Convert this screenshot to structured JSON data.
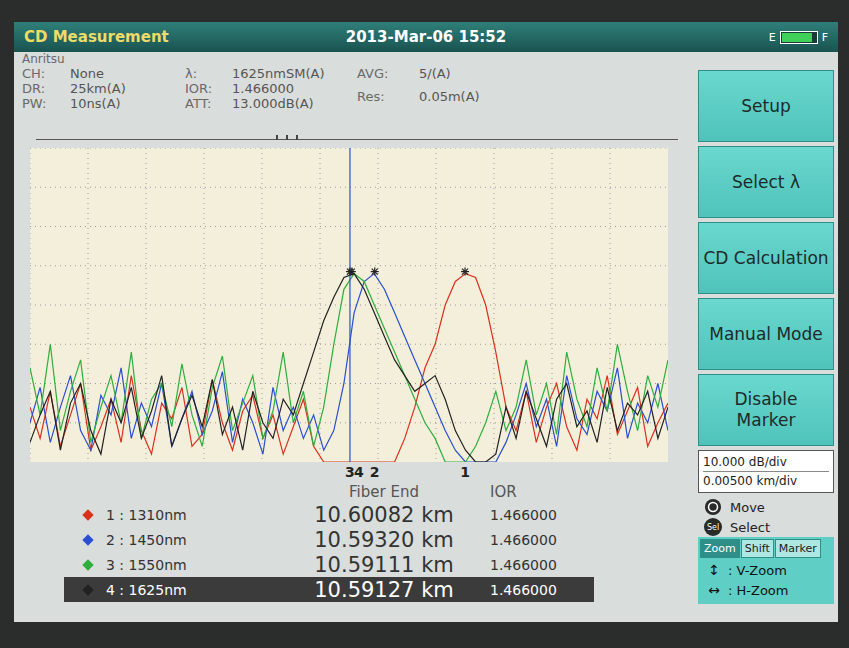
{
  "header": {
    "title": "CD Measurement",
    "datetime": "2013-Mar-06 15:52",
    "battery": {
      "empty_label": "E",
      "full_label": "F",
      "level": 0.9
    }
  },
  "brand": "Anritsu",
  "params": [
    [
      {
        "label": "CH:",
        "value": "None"
      },
      {
        "label": "DR:",
        "value": "25km(A)"
      },
      {
        "label": "PW:",
        "value": "10ns(A)"
      }
    ],
    [
      {
        "label": "λ:",
        "value": "1625nmSM(A)"
      },
      {
        "label": "IOR:",
        "value": "1.466000"
      },
      {
        "label": "ATT:",
        "value": "13.000dB(A)"
      }
    ],
    [
      {
        "label": "AVG:",
        "value": "5/(A)"
      },
      {
        "label": "Res:",
        "value": "0.05m(A)"
      }
    ]
  ],
  "chart": {
    "x_start_km": 10.56411,
    "x_end_km": 10.61795,
    "y_min_db": 0,
    "y_max_db": 80,
    "cursor_km": 10.59111,
    "series": [
      {
        "id": "1",
        "legend": "1 : 1310nm",
        "fiber_end": "10.60082 km",
        "ior": "1.466000",
        "km": 10.60082,
        "color": "#d8321e",
        "selected": false,
        "values": [
          14,
          6,
          18,
          4,
          12,
          20,
          3,
          9,
          16,
          5,
          22,
          8,
          2,
          15,
          11,
          19,
          4,
          7,
          21,
          10,
          3,
          13,
          17,
          6,
          12,
          2,
          9,
          16,
          4,
          0,
          0,
          0,
          0,
          0,
          0,
          0,
          0,
          6,
          14,
          24,
          30,
          40,
          46,
          48,
          47,
          40,
          28,
          14,
          8,
          18,
          5,
          14,
          20,
          9,
          3,
          16,
          11,
          22,
          7,
          13,
          19,
          4,
          10,
          15
        ]
      },
      {
        "id": "2",
        "legend": "2 : 1450nm",
        "fiber_end": "10.59320 km",
        "ior": "1.466000",
        "km": 10.5932,
        "color": "#2a4fd0",
        "selected": false,
        "values": [
          10,
          19,
          5,
          14,
          22,
          8,
          3,
          17,
          12,
          24,
          6,
          15,
          9,
          20,
          4,
          11,
          18,
          7,
          13,
          23,
          5,
          16,
          10,
          2,
          19,
          8,
          14,
          6,
          12,
          3,
          8,
          20,
          38,
          46,
          48,
          44,
          38,
          32,
          26,
          20,
          14,
          8,
          3,
          0,
          0,
          0,
          0,
          5,
          12,
          20,
          9,
          16,
          4,
          22,
          11,
          7,
          18,
          13,
          24,
          6,
          15,
          10,
          20,
          8
        ]
      },
      {
        "id": "3",
        "legend": "3 : 1550nm",
        "fiber_end": "10.59111 km",
        "ior": "1.466000",
        "km": 10.59111,
        "color": "#2fae3e",
        "selected": false,
        "values": [
          24,
          12,
          30,
          8,
          18,
          26,
          5,
          14,
          22,
          10,
          28,
          6,
          16,
          20,
          9,
          25,
          12,
          4,
          19,
          27,
          8,
          15,
          22,
          6,
          13,
          28,
          10,
          18,
          4,
          14,
          30,
          44,
          48,
          46,
          40,
          34,
          28,
          22,
          16,
          10,
          6,
          0,
          0,
          0,
          4,
          10,
          18,
          8,
          14,
          26,
          12,
          20,
          7,
          28,
          16,
          9,
          24,
          13,
          30,
          18,
          8,
          22,
          14,
          26
        ]
      },
      {
        "id": "4",
        "legend": "4 : 1625nm",
        "fiber_end": "10.59127 km",
        "ior": "1.466000",
        "km": 10.59127,
        "color": "#222222",
        "selected": true,
        "values": [
          5,
          12,
          18,
          3,
          15,
          20,
          8,
          2,
          16,
          10,
          19,
          6,
          13,
          22,
          4,
          11,
          17,
          9,
          21,
          7,
          14,
          3,
          18,
          10,
          6,
          16,
          12,
          20,
          28,
          36,
          42,
          47,
          48,
          44,
          38,
          32,
          26,
          22,
          18,
          20,
          22,
          16,
          8,
          3,
          0,
          0,
          2,
          14,
          6,
          18,
          11,
          4,
          16,
          20,
          9,
          13,
          5,
          19,
          8,
          15,
          12,
          18,
          6,
          14
        ]
      }
    ]
  },
  "table": {
    "columns": [
      "Fiber End",
      "IOR"
    ]
  },
  "menu": [
    {
      "label": "Setup"
    },
    {
      "label": "Select λ"
    },
    {
      "label": "CD Calculation"
    },
    {
      "label": "Manual Mode"
    },
    {
      "label": "Disable Marker"
    }
  ],
  "scales": [
    "10.000 dB/div",
    "0.00500 km/div"
  ],
  "keys": [
    {
      "kind": "dial",
      "label": "Move"
    },
    {
      "kind": "badge",
      "badge": "Sel",
      "label": "Select"
    }
  ],
  "tabs": [
    {
      "label": "Zoom",
      "selected": true
    },
    {
      "label": "Shift",
      "selected": false
    },
    {
      "label": "Marker",
      "selected": false
    }
  ],
  "zoom_keys": [
    {
      "symbol": "↕",
      "text": ": V-Zoom"
    },
    {
      "symbol": "↔",
      "text": ": H-Zoom"
    }
  ]
}
